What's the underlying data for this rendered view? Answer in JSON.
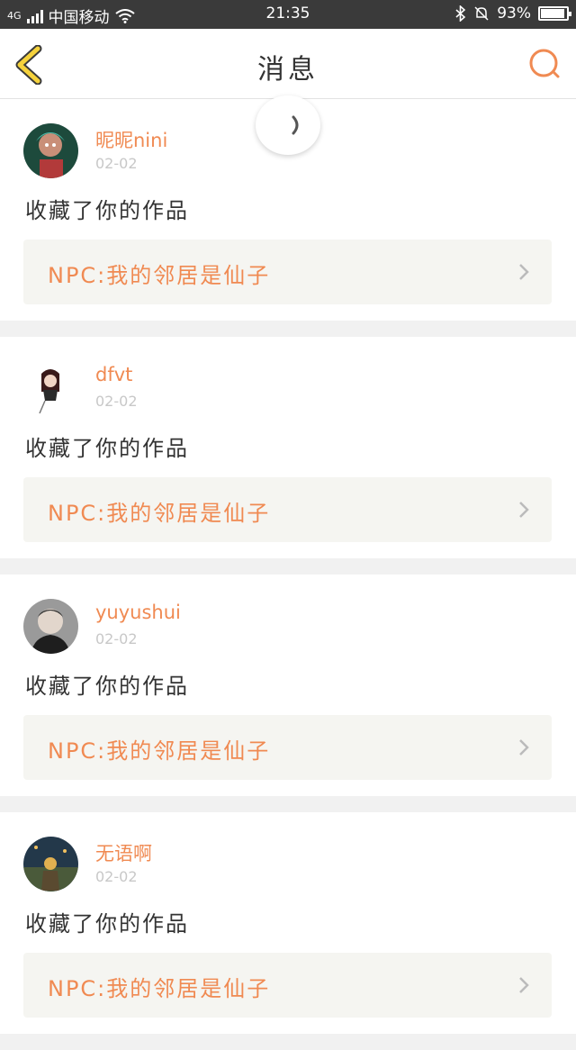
{
  "status_bar": {
    "network": "4G",
    "carrier": "中国移动",
    "time": "21:35",
    "battery": "93%",
    "battery_level": 0.93,
    "icons": [
      "signal-icon",
      "wifi-icon",
      "bluetooth-icon",
      "mute-icon",
      "battery-icon"
    ]
  },
  "header": {
    "title": "消息",
    "back_icon": "chevron-left-icon",
    "search_icon": "search-icon",
    "accent_color": "#f08a52",
    "back_color": "#f5d23c"
  },
  "messages": [
    {
      "user": "昵昵nini",
      "date": "02-02",
      "action": "收藏了你的作品",
      "work_title": "NPC:我的邻居是仙子"
    },
    {
      "user": "dfvt",
      "date": "02-02",
      "action": "收藏了你的作品",
      "work_title": "NPC:我的邻居是仙子"
    },
    {
      "user": "yuyushui",
      "date": "02-02",
      "action": "收藏了你的作品",
      "work_title": "NPC:我的邻居是仙子"
    },
    {
      "user": "无语啊",
      "date": "02-02",
      "action": "收藏了你的作品",
      "work_title": "NPC:我的邻居是仙子"
    }
  ]
}
